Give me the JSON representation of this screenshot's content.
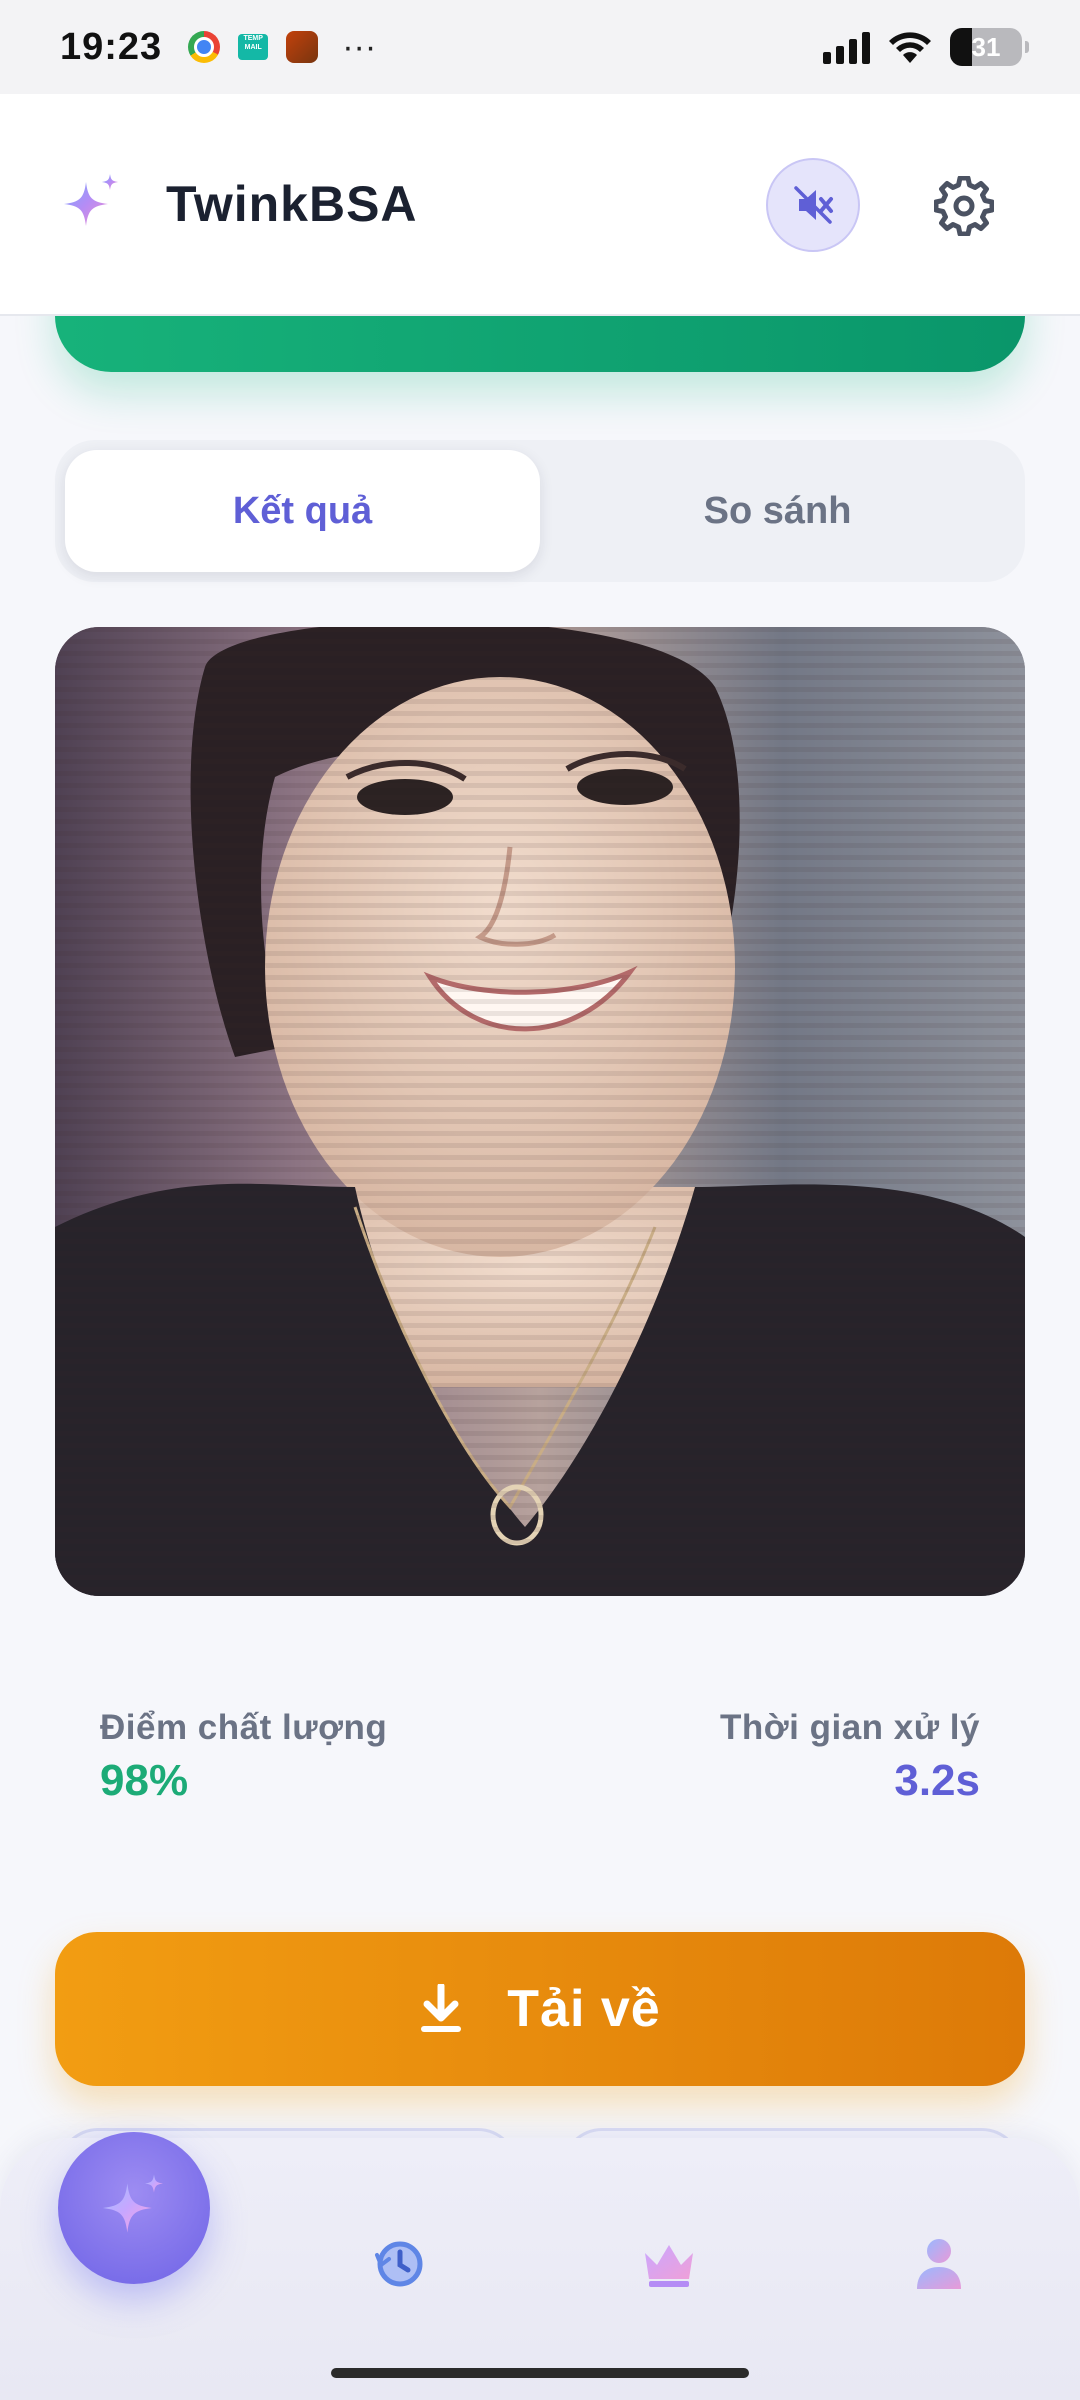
{
  "status_bar": {
    "time": "19:23",
    "battery": "31",
    "temp_app_label": "TEMP MAIL"
  },
  "header": {
    "title": "TwinkBSA",
    "icons": [
      "sparkle-logo-icon",
      "mute-icon",
      "gear-icon"
    ]
  },
  "tabs": [
    {
      "label": "Kết quả",
      "active": true
    },
    {
      "label": "So sánh",
      "active": false
    }
  ],
  "stats": {
    "quality_label": "Điểm chất lượng",
    "quality_value": "98%",
    "time_label": "Thời gian xử lý",
    "time_value": "3.2s"
  },
  "download": {
    "label": "Tải về",
    "icon": "download-icon"
  },
  "bottom_nav": {
    "items": [
      "sparkle-icon",
      "history-icon",
      "crown-icon",
      "profile-icon"
    ]
  },
  "colors": {
    "accent": "#5f5fd6",
    "success": "#1cab77",
    "download": "#f29d12",
    "green_banner": "#17b27a"
  }
}
